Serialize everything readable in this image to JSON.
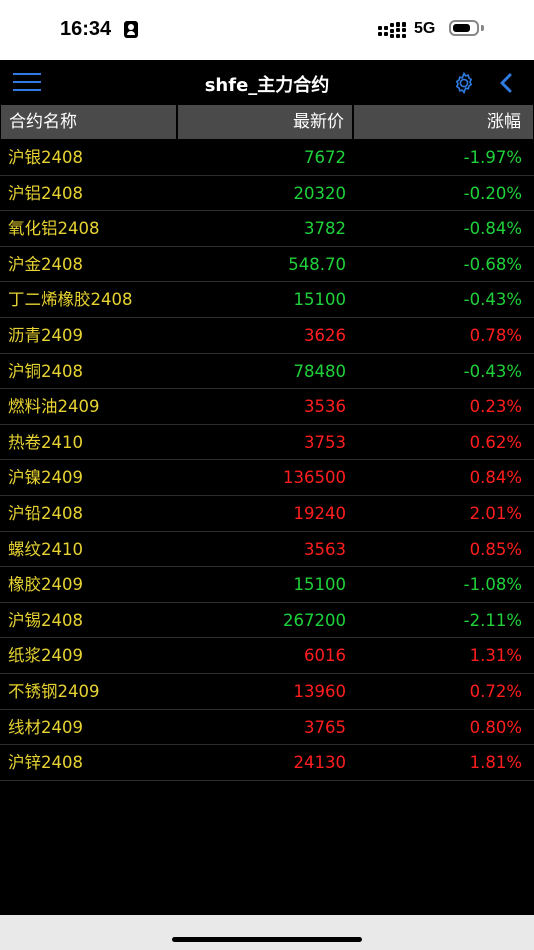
{
  "status_bar": {
    "time": "16:34",
    "network": "5G",
    "battery_level": 0.75
  },
  "nav": {
    "title": "shfe_主力合约",
    "menu_icon": "hamburger-menu-icon",
    "settings_icon": "gear-icon",
    "back_icon": "chevron-left-icon",
    "accent_color": "#2f7be0"
  },
  "table": {
    "headers": [
      "合约名称",
      "最新价",
      "涨幅"
    ],
    "rows": [
      {
        "name": "沪银2408",
        "price": "7672",
        "change": "-1.97%",
        "dir": "down"
      },
      {
        "name": "沪铝2408",
        "price": "20320",
        "change": "-0.20%",
        "dir": "down"
      },
      {
        "name": "氧化铝2408",
        "price": "3782",
        "change": "-0.84%",
        "dir": "down"
      },
      {
        "name": "沪金2408",
        "price": "548.70",
        "change": "-0.68%",
        "dir": "down"
      },
      {
        "name": "丁二烯橡胶2408",
        "price": "15100",
        "change": "-0.43%",
        "dir": "down"
      },
      {
        "name": "沥青2409",
        "price": "3626",
        "change": "0.78%",
        "dir": "up"
      },
      {
        "name": "沪铜2408",
        "price": "78480",
        "change": "-0.43%",
        "dir": "down"
      },
      {
        "name": "燃料油2409",
        "price": "3536",
        "change": "0.23%",
        "dir": "up"
      },
      {
        "name": "热卷2410",
        "price": "3753",
        "change": "0.62%",
        "dir": "up"
      },
      {
        "name": "沪镍2409",
        "price": "136500",
        "change": "0.84%",
        "dir": "up"
      },
      {
        "name": "沪铅2408",
        "price": "19240",
        "change": "2.01%",
        "dir": "up"
      },
      {
        "name": "螺纹2410",
        "price": "3563",
        "change": "0.85%",
        "dir": "up"
      },
      {
        "name": "橡胶2409",
        "price": "15100",
        "change": "-1.08%",
        "dir": "down"
      },
      {
        "name": "沪锡2408",
        "price": "267200",
        "change": "-2.11%",
        "dir": "down"
      },
      {
        "name": "纸浆2409",
        "price": "6016",
        "change": "1.31%",
        "dir": "up"
      },
      {
        "name": "不锈钢2409",
        "price": "13960",
        "change": "0.72%",
        "dir": "up"
      },
      {
        "name": "线材2409",
        "price": "3765",
        "change": "0.80%",
        "dir": "up"
      },
      {
        "name": "沪锌2408",
        "price": "24130",
        "change": "1.81%",
        "dir": "up"
      }
    ]
  },
  "colors": {
    "name": "#e6d232",
    "up": "#ff1e1e",
    "down": "#1fd23a",
    "header_bg": "#4a4a4a"
  }
}
